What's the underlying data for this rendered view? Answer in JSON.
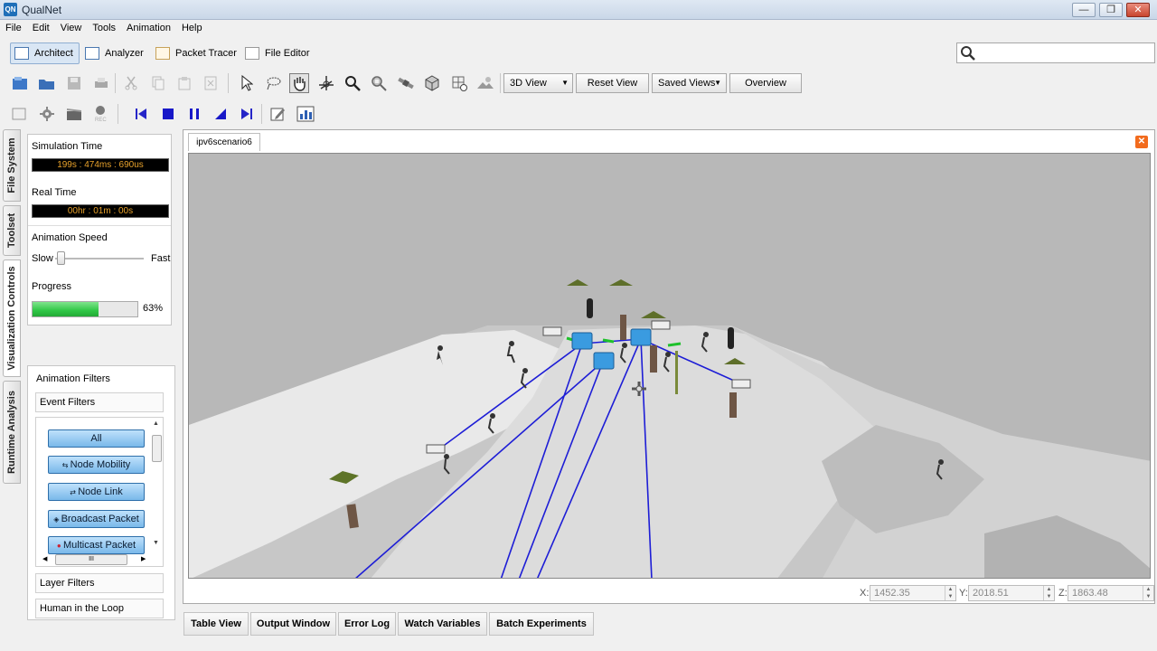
{
  "window": {
    "title": "QualNet",
    "app_icon_text": "QN",
    "controls": [
      "—",
      "❐",
      "✕"
    ]
  },
  "menu": [
    "File",
    "Edit",
    "View",
    "Tools",
    "Animation",
    "Help"
  ],
  "perspectives": [
    "Architect",
    "Analyzer",
    "Packet Tracer",
    "File Editor"
  ],
  "view_toolbar": {
    "view_select": "3D View",
    "reset_view": "Reset View",
    "saved_views": "Saved Views",
    "overview": "Overview"
  },
  "side_tabs": [
    "File System",
    "Toolset",
    "Visualization Controls",
    "Runtime Analysis"
  ],
  "runtime": {
    "sim_time_label": "Simulation Time",
    "sim_time_value": "199s : 474ms : 690us",
    "real_time_label": "Real Time",
    "real_time_value": "00hr : 01m : 00s",
    "speed_label": "Animation Speed",
    "slow": "Slow",
    "fast": "Fast",
    "speed_level": 0.02,
    "progress_label": "Progress",
    "progress_value": 63,
    "progress_text": "63%"
  },
  "filters": {
    "title": "Animation Filters",
    "event_filters": "Event Filters",
    "buttons": [
      "All",
      "Node Mobility",
      "Node Link",
      "Broadcast Packet",
      "Multicast Packet"
    ],
    "layer_filters": "Layer Filters",
    "hitl": "Human in the Loop",
    "scroll_grip": "III"
  },
  "scenario_tab": "ipv6scenario6",
  "coords": {
    "x_label": "X:",
    "x": "1452.35",
    "y_label": "Y:",
    "y": "2018.51",
    "z_label": "Z:",
    "z": "1863.48"
  },
  "bottom_tabs": [
    "Table View",
    "Output Window",
    "Error Log",
    "Watch Variables",
    "Batch Experiments"
  ],
  "colors": {
    "link": "#1d1dd6",
    "progress": "#2fc645",
    "lcd_text": "#e8a22b",
    "filter_button": "#8fc4ee"
  }
}
